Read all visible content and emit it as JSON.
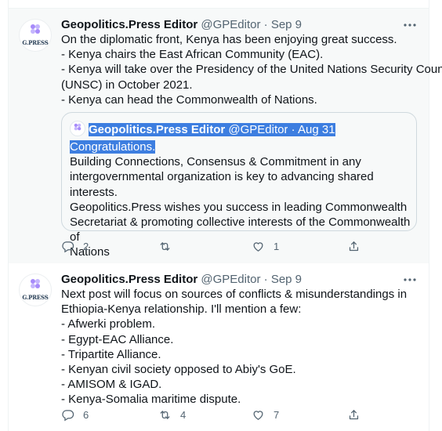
{
  "tweets": [
    {
      "avatar_text": "G.PRESS",
      "name": "Geopolitics.Press Editor",
      "handle": "@GPEditor",
      "separator": "·",
      "date": "Sep 9",
      "lines": [
        "On the diplomatic front, Kenya has been enjoying great success.",
        "- Kenya chairs the East African Community (EAC).",
        "- Kenya will take over the Presidency of the United Nations Security Council",
        "(UNSC) in October 2021.",
        "- Kenya can head the Commonwealth of Nations."
      ],
      "quote": {
        "name": "Geopolitics.Press Editor",
        "handle": "@GPEditor",
        "date": "Aug 31",
        "highlighted_line": "Congratulations.",
        "lines": [
          "Building Connections, Consensus & Commitment in any",
          "intergovernmental organization is key to advancing shared interests.",
          "Geopolitics.Press wishes you success in leading Commonwealth",
          "Secretariat & promoting collective interests of the Commonwealth of",
          "Nations"
        ]
      },
      "replies": "2",
      "retweets": "",
      "likes": "1"
    },
    {
      "avatar_text": "G.PRESS",
      "name": "Geopolitics.Press Editor",
      "handle": "@GPEditor",
      "separator": "·",
      "date": "Sep 9",
      "lines": [
        "Next post will focus on sources of conflicts & misunderstandings in",
        "Ethiopia-Kenya relationship. I'll mention a few:",
        "- Afwerki problem.",
        "- Egypt-EAC Alliance.",
        "- Tripartite Alliance.",
        "- Kenyan civil society opposed to Abiy's GoE.",
        "- AMISOM & IGAD.",
        "- Kenya-Somalia maritime dispute."
      ],
      "replies": "6",
      "retweets": "4",
      "likes": "7"
    }
  ],
  "icons": {
    "more": "more-horizontal-icon",
    "reply": "reply-icon",
    "retweet": "retweet-icon",
    "like": "like-icon",
    "share": "share-icon"
  },
  "colors": {
    "highlight": "#3d7ee0",
    "secondary_text": "#536471",
    "hover_background": "#f7f9f9"
  }
}
